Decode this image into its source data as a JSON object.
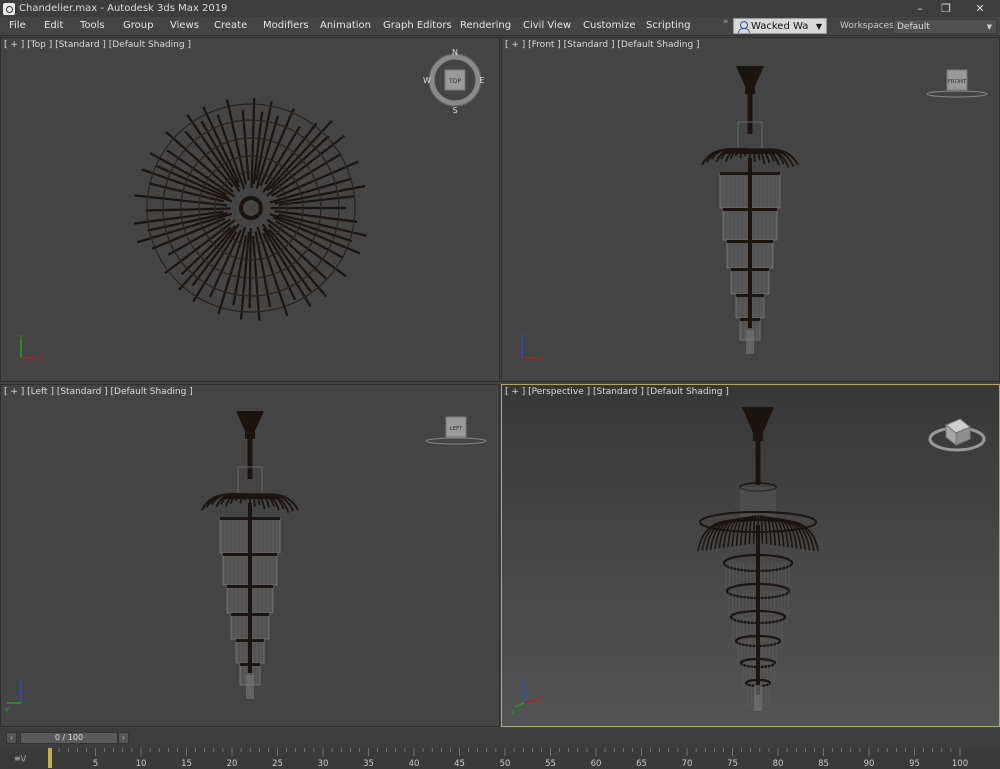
{
  "window": {
    "title": "Chandelier.max - Autodesk 3ds Max 2019",
    "minimize_glyph": "–",
    "maximize_glyph": "❐",
    "close_glyph": "✕"
  },
  "menu": {
    "items": [
      "File",
      "Edit",
      "Tools",
      "Group",
      "Views",
      "Create",
      "Modifiers",
      "Animation",
      "Graph Editors",
      "Rendering",
      "Civil View",
      "Customize",
      "Scripting"
    ],
    "overflow_glyph": "»",
    "account_name": "Wacked Wa",
    "account_caret": "▼",
    "workspaces_label": "Workspaces:",
    "workspace_value": "Default",
    "workspace_caret": "▼"
  },
  "viewports": {
    "top": {
      "label": "[ + ] [Top ] [Standard ] [Default Shading ]",
      "nav": "TOP"
    },
    "front": {
      "label": "[ + ] [Front ] [Standard ] [Default Shading ]",
      "nav": "FRONT"
    },
    "left": {
      "label": "[ + ] [Left ] [Standard ] [Default Shading ]",
      "nav": "LEFT"
    },
    "perspective": {
      "label": "[ + ] [Perspective ] [Standard ] [Default Shading ]",
      "nav": ""
    }
  },
  "compass": {
    "n": "N",
    "s": "S",
    "e": "E",
    "w": "W"
  },
  "axis": {
    "x": "x",
    "y": "y",
    "z": "z"
  },
  "timeline": {
    "prev_glyph": "‹",
    "next_glyph": "›",
    "slider_text": "0 / 100",
    "current_frame": 0,
    "ticks": [
      0,
      5,
      10,
      15,
      20,
      25,
      30,
      35,
      40,
      45,
      50,
      55,
      60,
      65,
      70,
      75,
      80,
      85,
      90,
      95,
      100
    ],
    "fn_icon": "≡\\/"
  },
  "colors": {
    "viewport_bg": "#444444",
    "active_border": "#b8a45c",
    "model_dark": "#1b1410",
    "glass": "#6a6a6a",
    "x_axis": "#b02020",
    "y_axis": "#20a020",
    "z_axis": "#3050c0"
  }
}
